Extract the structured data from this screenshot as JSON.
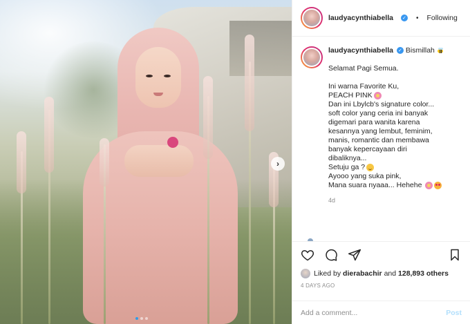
{
  "header": {
    "username": "laudyacynthiabella",
    "separator": "•",
    "follow_state": "Following"
  },
  "caption": {
    "username": "laudyacynthiabella",
    "lines": [
      "Bismillah",
      "",
      "Selamat Pagi Semua.",
      "",
      "Ini warna Favorite Ku,",
      "PEACH PINK",
      "Dan ini Lbylcb's signature color...",
      "soft color yang ceria ini banyak",
      "digemari para wanita karena",
      "kesannya yang lembut, feminim,",
      "manis, romantic dan membawa",
      "banyak kepercayaan diri",
      "dibaliknya...",
      "Setuju ga ?",
      "Ayooo yang suka pink,",
      "Mana suara nyaaa... Hehehe"
    ],
    "time_ago": "4d"
  },
  "likes": {
    "prefix": "Liked by",
    "user": "dierabachir",
    "connector": "and",
    "count": "128,893 others"
  },
  "date": "4 DAYS AGO",
  "comment": {
    "placeholder": "Add a comment...",
    "post_label": "Post"
  },
  "icons": {
    "like": "heart-icon",
    "comment": "comment-bubble-icon",
    "share": "paper-plane-icon",
    "save": "bookmark-icon",
    "verified": "verified-badge-icon",
    "next": "chevron-right-icon"
  },
  "colors": {
    "verified": "#3897f0",
    "post_button": "#b2dffc",
    "active_dot": "#2f9ce8"
  },
  "carousel": {
    "slides": 3,
    "active": 1
  }
}
